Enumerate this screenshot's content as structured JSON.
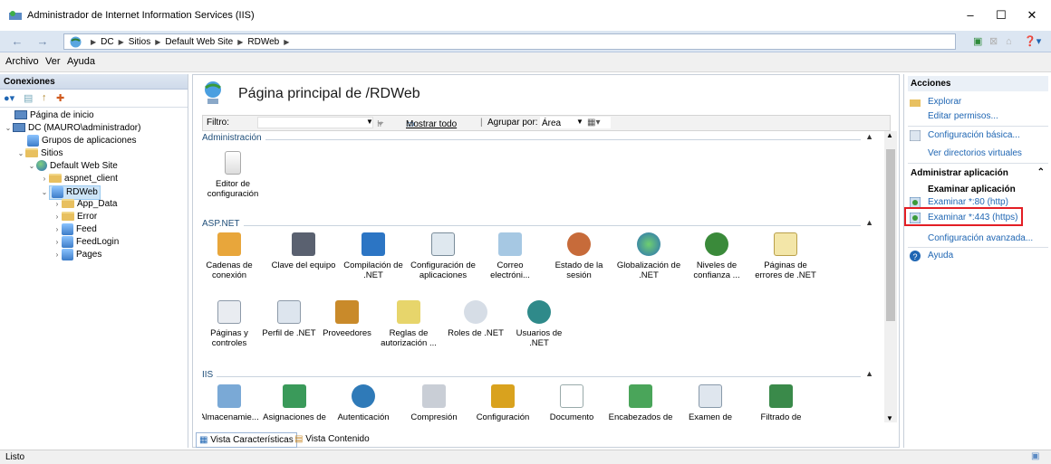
{
  "window": {
    "title": "Administrador de Internet Information Services (IIS)",
    "minimize": "–",
    "maximize": "☐",
    "close": "✕"
  },
  "address": {
    "back": "←",
    "forward": "→",
    "crumbs": [
      "DC",
      "Sitios",
      "Default Web Site",
      "RDWeb"
    ]
  },
  "menu": {
    "archivo": "Archivo",
    "ver": "Ver",
    "ayuda": "Ayuda"
  },
  "left": {
    "header": "Conexiones",
    "tree": {
      "start": "Página de inicio",
      "dc": "DC (MAURO\\administrador)",
      "pools": "Grupos de aplicaciones",
      "sites": "Sitios",
      "dws": "Default Web Site",
      "aspnet_client": "aspnet_client",
      "rdweb": "RDWeb",
      "app_data": "App_Data",
      "error": "Error",
      "feed": "Feed",
      "feedlogin": "FeedLogin",
      "pages": "Pages"
    }
  },
  "center": {
    "title": "Página principal de /RDWeb",
    "filter": {
      "label": "Filtro:",
      "ir": "Ir",
      "show_all": "Mostrar todo",
      "group_by": "Agrupar por:",
      "group_value": "Área"
    },
    "groups": {
      "admin": {
        "label": "Administración",
        "items": [
          "Editor de configuración"
        ]
      },
      "aspnet": {
        "label": "ASP.NET",
        "items": [
          "Cadenas de conexión",
          "Clave del equipo",
          "Compilación de .NET",
          "Configuración de aplicaciones",
          "Correo electróni...",
          "Estado de la sesión",
          "Globalización de .NET",
          "Niveles de confianza ...",
          "Páginas de errores de .NET",
          "Páginas y controles",
          "Perfil de .NET",
          "Proveedores",
          "Reglas de autorización ...",
          "Roles de .NET",
          "Usuarios de .NET"
        ]
      },
      "iis": {
        "label": "IIS",
        "items": [
          "Almacenamie...",
          "Asignaciones de",
          "Autenticación",
          "Compresión",
          "Configuración",
          "Documento",
          "Encabezados de",
          "Examen de",
          "Filtrado de"
        ]
      }
    },
    "tabs": {
      "features": "Vista Características",
      "content": "Vista Contenido"
    }
  },
  "right": {
    "header": "Acciones",
    "explore": "Explorar",
    "edit_perms": "Editar permisos...",
    "basic_config": "Configuración básica...",
    "virtual_dirs": "Ver directorios virtuales",
    "manage_app": "Administrar aplicación",
    "browse_app": "Examinar aplicación",
    "browse_80": "Examinar *:80 (http)",
    "browse_443": "Examinar *:443 (https)",
    "advanced": "Configuración avanzada...",
    "help": "Ayuda"
  },
  "status": {
    "text": "Listo"
  }
}
